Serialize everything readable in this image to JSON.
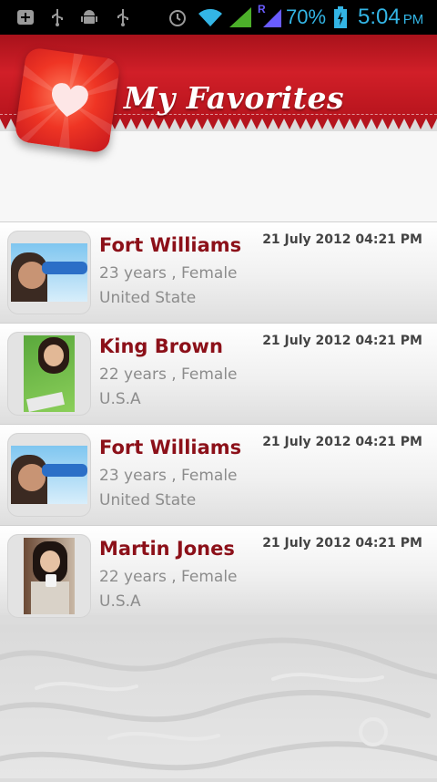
{
  "status_bar": {
    "battery_percent": "70%",
    "time": "5:04",
    "ampm": "PM",
    "network_label": "R",
    "accent_color": "#33b5e5"
  },
  "header": {
    "title": "My Favorites",
    "brand_color": "#c41a22"
  },
  "favorites": [
    {
      "name": "Fort Williams",
      "details": "23 years , Female",
      "country": "United State",
      "date": "21 July 2012 04:21 PM",
      "photo": "person-drinking-photo"
    },
    {
      "name": "King Brown",
      "details": "22 years , Female",
      "country": "U.S.A",
      "date": "21 July 2012 04:21 PM",
      "photo": "person-on-grass-photo"
    },
    {
      "name": "Fort Williams",
      "details": "23 years , Female",
      "country": "United State",
      "date": "21 July 2012 04:21 PM",
      "photo": "person-drinking-photo"
    },
    {
      "name": "Martin Jones",
      "details": "22 years , Female",
      "country": "U.S.A",
      "date": "21 July 2012 04:21 PM",
      "photo": "person-with-cup-photo"
    }
  ]
}
